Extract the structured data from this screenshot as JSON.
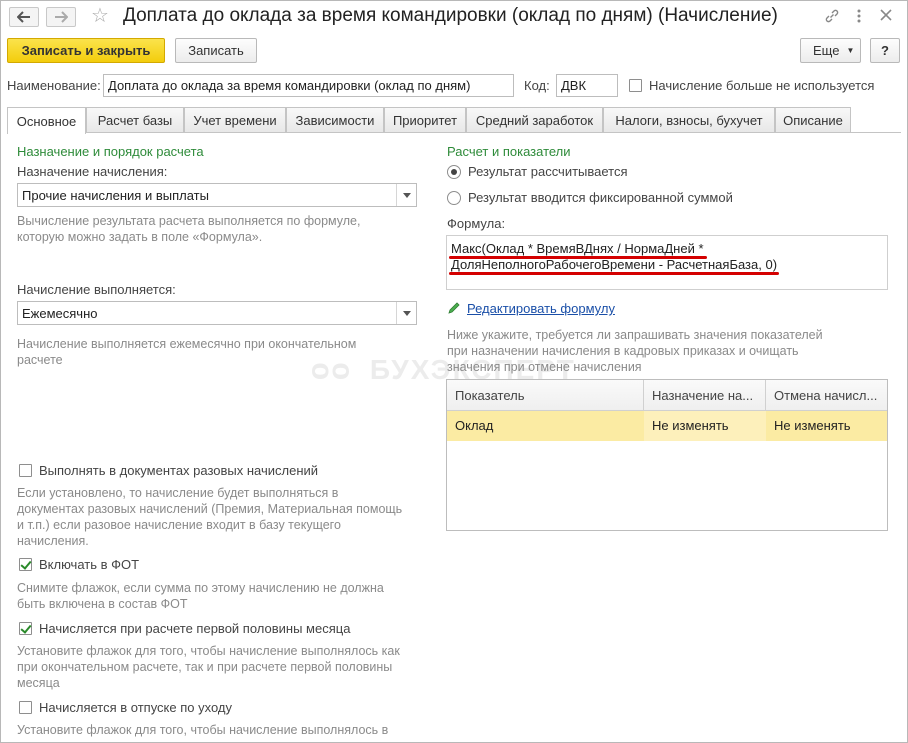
{
  "window": {
    "title": "Доплата до оклада за время командировки (оклад по дням) (Начисление)"
  },
  "toolbar": {
    "save_close_label": "Записать и закрыть",
    "save_label": "Записать",
    "more_label": "Еще",
    "help_label": "?"
  },
  "header": {
    "name_label": "Наименование:",
    "name_value": "Доплата до оклада за время командировки (оклад по дням)",
    "code_label": "Код:",
    "code_value": "ДВК",
    "unused_label": "Начисление больше не используется"
  },
  "tabs": [
    {
      "label": "Основное"
    },
    {
      "label": "Расчет базы"
    },
    {
      "label": "Учет времени"
    },
    {
      "label": "Зависимости"
    },
    {
      "label": "Приоритет"
    },
    {
      "label": "Средний заработок"
    },
    {
      "label": "Налоги, взносы, бухучет"
    },
    {
      "label": "Описание"
    }
  ],
  "left": {
    "section_title": "Назначение и порядок расчета",
    "purpose_label": "Назначение начисления:",
    "purpose_value": "Прочие начисления и выплаты",
    "purpose_hint_1": "Вычисление результата расчета выполняется по формуле,",
    "purpose_hint_2": "которую можно задать в поле «Формула».",
    "period_label": "Начисление выполняется:",
    "period_value": "Ежемесячно",
    "period_hint_1": "Начисление выполняется ежемесячно при окончательном",
    "period_hint_2": "расчете",
    "onetime_label": "Выполнять в документах разовых начислений",
    "onetime_hint_1": "Если установлено, то начисление будет выполняться в",
    "onetime_hint_2": "документах разовых начислений (Премия, Материальная помощь",
    "onetime_hint_3": "и т.п.) если разовое начисление входит в базу текущего",
    "onetime_hint_4": "начисления.",
    "fot_label": "Включать в ФОТ",
    "fot_hint_1": "Снимите флажок, если сумма по этому начислению не должна",
    "fot_hint_2": "быть включена в состав ФОТ",
    "half_label": "Начисляется при расчете первой половины месяца",
    "half_hint_1": "Установите флажок для того, чтобы начисление выполнялось как",
    "half_hint_2": "при окончательном расчете, так и при расчете первой половины",
    "half_hint_3": "месяца",
    "leave_label": "Начисляется в отпуске по уходу",
    "leave_hint_1": "Установите флажок для того, чтобы начисление выполнялось в"
  },
  "right": {
    "section_title": "Расчет и показатели",
    "radio_calc_label": "Результат рассчитывается",
    "radio_fixed_label": "Результат вводится фиксированной суммой",
    "formula_label": "Формула:",
    "formula_line_1": "Макс(Оклад * ВремяВДнях / НормаДней *",
    "formula_line_2": "ДоляНеполногоРабочегоВремени - РасчетнаяБаза, 0)",
    "edit_formula_link": "Редактировать формулу",
    "indicators_hint_1": "Ниже укажите, требуется ли запрашивать значения показателей",
    "indicators_hint_2": "при назначении начисления в кадровых приказах и очищать",
    "indicators_hint_3": "значения при отмене начисления",
    "table": {
      "columns": [
        "Показатель",
        "Назначение на...",
        "Отмена начисл..."
      ],
      "rows": [
        [
          "Оклад",
          "Не изменять",
          "Не изменять"
        ]
      ]
    }
  },
  "watermark": "БУХЭКСПЕРТ",
  "colors": {
    "accent_green": "#2e8b3a",
    "primary_button": "#f3cd0c",
    "selected_row": "#fbeba3",
    "annotation_red": "#d40000"
  }
}
